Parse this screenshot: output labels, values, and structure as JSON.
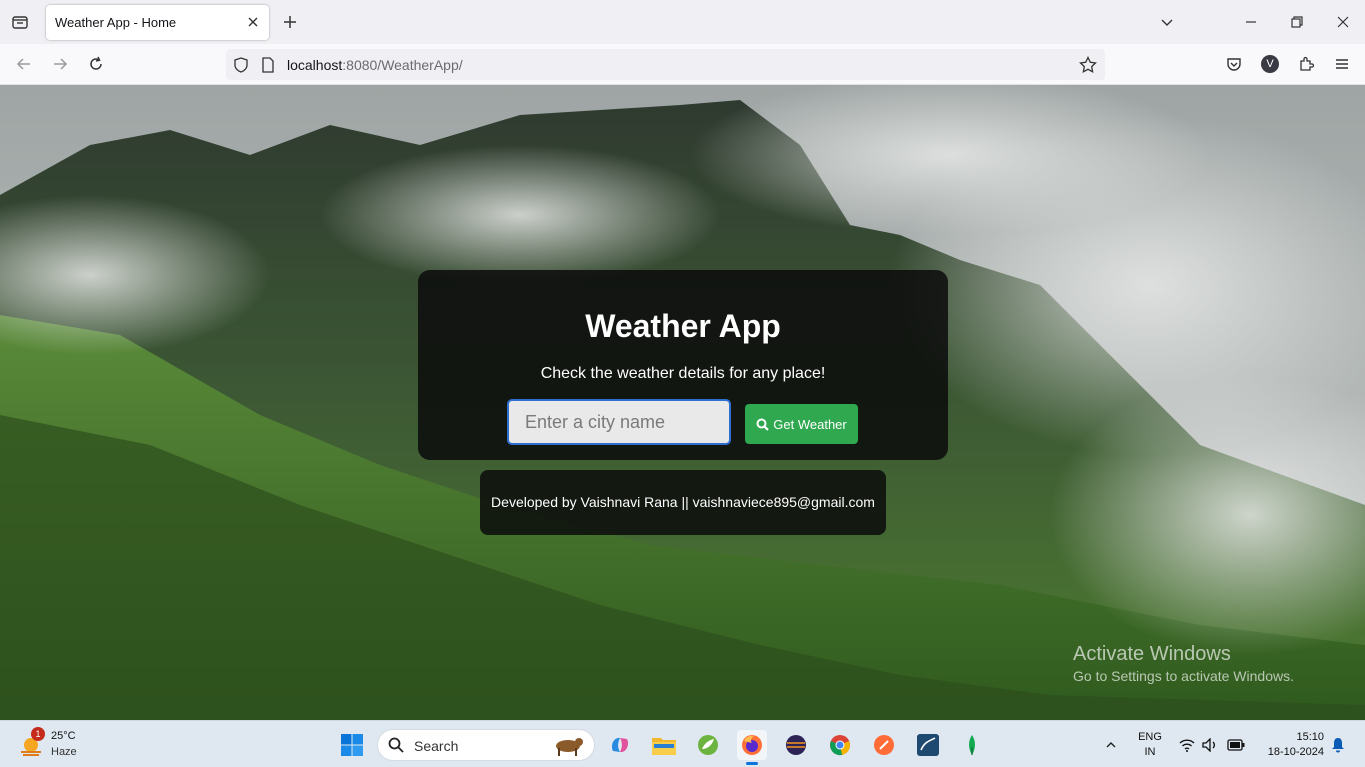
{
  "browser": {
    "tab_title": "Weather App - Home",
    "url_host": "localhost",
    "url_rest": ":8080/WeatherApp/",
    "profile_initial": "V"
  },
  "page": {
    "title": "Weather App",
    "subtitle": "Check the weather details for any place!",
    "search_placeholder": "Enter a city name",
    "button_label": "Get Weather",
    "footer": "Developed by Vaishnavi Rana || vaishnaviece895@gmail.com"
  },
  "watermark": {
    "title": "Activate Windows",
    "subtitle": "Go to Settings to activate Windows."
  },
  "taskbar": {
    "weather_temp": "25°C",
    "weather_condition": "Haze",
    "weather_badge": "1",
    "search_label": "Search",
    "lang_line1": "ENG",
    "lang_line2": "IN",
    "time": "15:10",
    "date": "18-10-2024"
  },
  "colors": {
    "accent_button": "#2fa84f",
    "input_focus_border": "#2f6fd1",
    "card_background": "rgba(12,12,12,0.86)"
  }
}
